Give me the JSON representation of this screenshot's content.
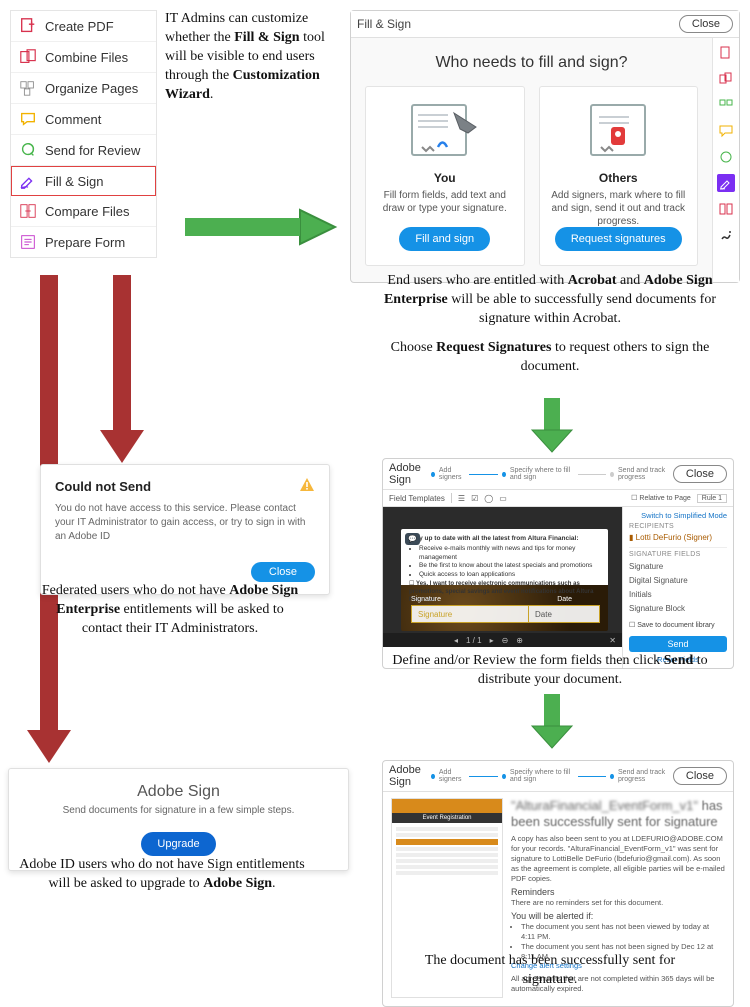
{
  "tools": {
    "items": [
      {
        "label": "Create PDF",
        "icon": "create-pdf",
        "color": "#d8324e"
      },
      {
        "label": "Combine Files",
        "icon": "combine",
        "color": "#d8324e"
      },
      {
        "label": "Organize Pages",
        "icon": "organize",
        "color": "#8e8e8e"
      },
      {
        "label": "Comment",
        "icon": "comment",
        "color": "#f2b200"
      },
      {
        "label": "Send for Review",
        "icon": "send-review",
        "color": "#47b54b"
      },
      {
        "label": "Fill & Sign",
        "icon": "fill-sign",
        "color": "#7b2ff2",
        "highlight": true
      },
      {
        "label": "Compare Files",
        "icon": "compare",
        "color": "#d8324e"
      },
      {
        "label": "Prepare Form",
        "icon": "prepare-form",
        "color": "#c231c9"
      }
    ]
  },
  "top_caption": {
    "pre": "IT Admins can customize whether the ",
    "bold1": "Fill & Sign",
    "mid": " tool will be visible to end users through the ",
    "bold2": "Customization Wizard",
    "post": "."
  },
  "fill_sign": {
    "header": "Fill & Sign",
    "close": "Close",
    "question": "Who needs to fill and sign?",
    "you": {
      "title": "You",
      "desc": "Fill form fields, add text and draw or type your signature.",
      "button": "Fill and sign"
    },
    "others": {
      "title": "Others",
      "desc": "Add signers, mark where to fill and sign, send it out and track progress.",
      "button": "Request signatures"
    }
  },
  "cap_entitled": {
    "line1_pre": "End users who are entitled with ",
    "bold1": "Acrobat",
    "mid1": " and ",
    "bold2": "Adobe Sign Enterprise",
    "line1_post": " will be able to successfully send documents for signature within Acrobat.",
    "line2_pre": "Choose ",
    "bold3": "Request Signatures",
    "line2_post": " to request others to sign the document."
  },
  "error": {
    "title": "Could not Send",
    "body": "You do not have access to this service. Please contact your IT Administrator to gain access, or try to sign in with an Adobe ID",
    "close": "Close"
  },
  "cap_federated": {
    "pre": "Federated users who do not have ",
    "bold": "Adobe Sign Enterprise",
    "post": " entitlements will be asked to contact their IT Administrators."
  },
  "upgrade": {
    "title": "Adobe Sign",
    "sub": "Send documents for signature in a few simple steps.",
    "button": "Upgrade"
  },
  "cap_adobeid": {
    "pre": "Adobe ID users who do not have Sign entitlements will be asked to upgrade to ",
    "bold": "Adobe Sign",
    "post": "."
  },
  "adobe_sign_edit": {
    "title": "Adobe Sign",
    "close": "Close",
    "steps": {
      "s1": "Add signers",
      "s2": "Specify where to fill and sign",
      "s3": "Send and track progress"
    },
    "toolbar": {
      "field_templates": "Field Templates",
      "relative": "Relative to Page",
      "rule": "Rule 1"
    },
    "promo": {
      "h": "Stay up to date with all the latest from Altura Financial:",
      "b1": "Receive e-mails monthly with news and tips for money management",
      "b2": "Be the first to know about the latest specials and promotions",
      "b3": "Quick access to loan applications",
      "opt": "Yes, I want to receive electronic communications such as promotions, special savings and event notifications about Altura Financial."
    },
    "sig_label": "Signature",
    "sig_field": "Signature",
    "date_label": "Date",
    "date_field": "Date",
    "page_ind": "1 / 1",
    "side": {
      "switch": "Switch to Simplified Mode",
      "recipients_lbl": "RECIPIENTS",
      "recipient": "Lotti DeFurio (Signer)",
      "sigfields_lbl": "Signature Fields",
      "f1": "Signature",
      "f2": "Digital Signature",
      "f3": "Initials",
      "f4": "Signature Block",
      "save": "Save to document library",
      "send": "Send",
      "reset": "Reset Fields"
    }
  },
  "cap_define": {
    "pre": "Define and/or Review the form fields then click ",
    "bold": "Send",
    "post": " to distribute your document."
  },
  "adobe_sign_sent": {
    "title": "Adobe Sign",
    "close": "Close",
    "steps": {
      "s1": "Add signers",
      "s2": "Specify where to fill and sign",
      "s3": "Send and track progress"
    },
    "headline_blur": "\"AlturaFinancial_EventForm_v1\"",
    "headline_tail": " has been successfully sent for signature",
    "p1": "A copy has also been sent to you at LDEFURIO@ADOBE.COM for your records. \"AlturaFinancial_EventForm_v1\" was sent for signature to LottiBelle DeFurio (lbdefurio@gmail.com). As soon as the agreement is complete, all eligible parties will be e-mailed PDF copies.",
    "reminders_h": "Reminders",
    "reminders_p": "There are no reminders set for this document.",
    "alerts_h": "You will be alerted if:",
    "a1": "The document you sent has not been viewed by today at 4:11 PM.",
    "a2": "The document you sent has not been signed by Dec 12 at 8:11 AM.",
    "change": "Change alert settings",
    "foot": "All agreements that are not completed within 365 days will be automatically expired.",
    "thumb_banner": "Event Registration"
  },
  "cap_sent": "The document has been successfully sent for signature."
}
